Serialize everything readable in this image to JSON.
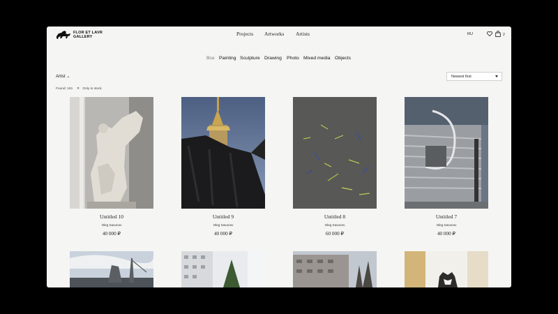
{
  "brand": {
    "line1": "FLOR ET LAVR",
    "line2": "GALLERY",
    "mark_icon": "horse-icon"
  },
  "nav": {
    "items": [
      "Projects",
      "Artworks",
      "Artists"
    ]
  },
  "header": {
    "lang": "RU",
    "wishlist_icon": "heart-icon",
    "cart_icon": "bag-icon",
    "cart_count": "2"
  },
  "categories": {
    "items": [
      "Все",
      "Painting",
      "Sculpture",
      "Drawing",
      "Photo",
      "Mixed media",
      "Objects"
    ],
    "active": "Все"
  },
  "filters": {
    "artist_label": "Artist",
    "artist_chevron": "⌄",
    "sort_value": "Newest first",
    "found": "Found: 191",
    "stock_x": "✕",
    "stock_label": "Only in stock"
  },
  "artworks": [
    {
      "title": "Untitled 10",
      "artist": "Oleg Savunov",
      "price": "40 000 ₽"
    },
    {
      "title": "Untitled 9",
      "artist": "Oleg Savunov",
      "price": "40 000 ₽"
    },
    {
      "title": "Untitled 8",
      "artist": "Oleg Savunov",
      "price": "60 000 ₽"
    },
    {
      "title": "Untitled 7",
      "artist": "Oleg Savunov",
      "price": "40 000 ₽"
    }
  ]
}
